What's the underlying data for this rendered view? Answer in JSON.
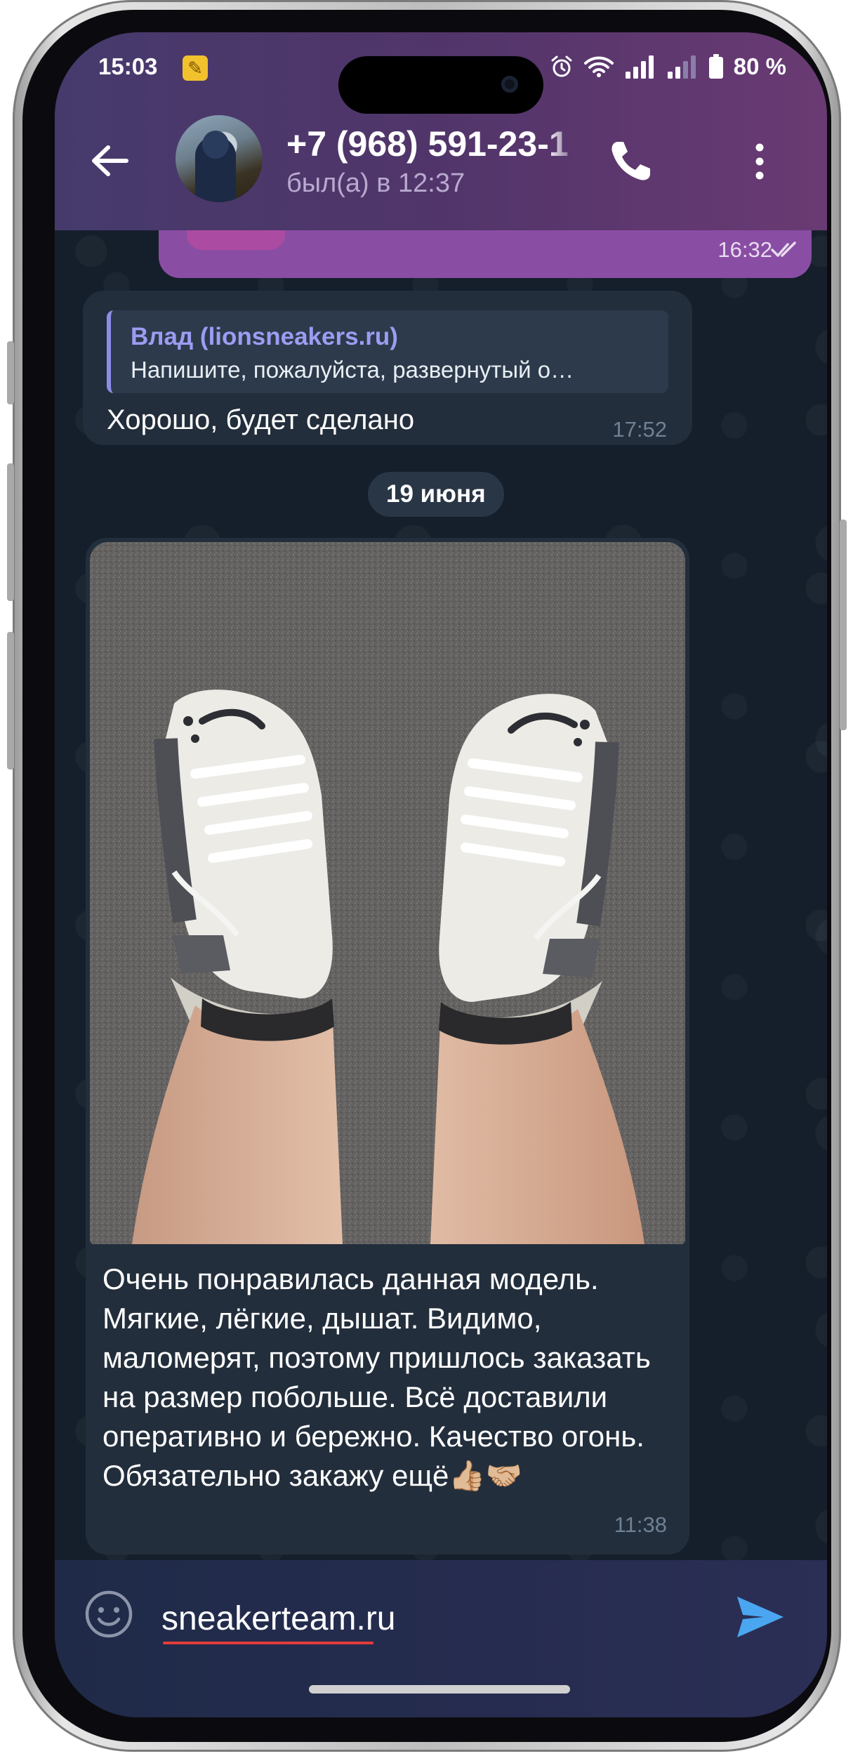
{
  "status_bar": {
    "time": "15:03",
    "battery": "80 %"
  },
  "header": {
    "contact_name": "+7 (968) 591-23-1",
    "last_seen": "был(а) в 12:37"
  },
  "messages": {
    "outgoing_prev": {
      "time": "16:32"
    },
    "incoming_reply": {
      "reply_author": "Влад (lionsneakers.ru)",
      "reply_preview": "Напишите, пожалуйста, развернутый о…",
      "text": "Хорошо, будет сделано",
      "time": "17:52"
    },
    "date_separator": "19 июня",
    "incoming_photo": {
      "text": "Очень понравилась данная модель. Мягкие, лёгкие, дышат. Видимо, маломерят, поэтому пришлось заказать на размер побольше. Всё доставили оперативно и бережно. Качество огонь. Обязательно закажу ещё👍🏼🤝🏼",
      "time": "11:38"
    }
  },
  "input": {
    "value": "sneakerteam.ru"
  },
  "colors": {
    "header_start": "#463a6c",
    "header_end": "#6a3a73",
    "outgoing_bubble": "#8a4da4",
    "incoming_bubble": "#232e3c",
    "reply_accent": "#8f8ce5",
    "send_icon": "#4aa6f0"
  },
  "icons": {
    "back": "arrow-left-icon",
    "call": "phone-icon",
    "menu": "more-vertical-icon",
    "emoji": "smile-icon",
    "send": "send-icon",
    "read": "double-check-icon"
  }
}
